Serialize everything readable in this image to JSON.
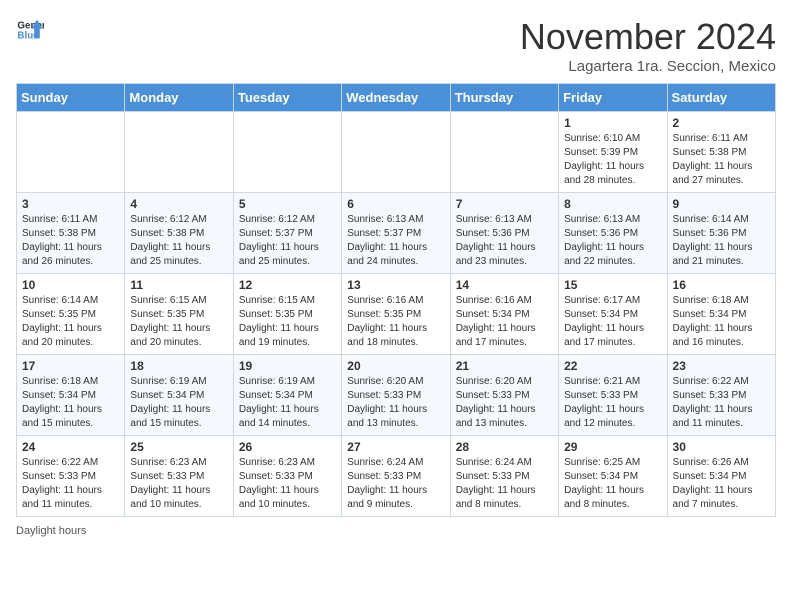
{
  "header": {
    "logo_general": "General",
    "logo_blue": "Blue",
    "month_title": "November 2024",
    "subtitle": "Lagartera 1ra. Seccion, Mexico"
  },
  "days_of_week": [
    "Sunday",
    "Monday",
    "Tuesday",
    "Wednesday",
    "Thursday",
    "Friday",
    "Saturday"
  ],
  "footer": {
    "daylight_hours": "Daylight hours"
  },
  "weeks": [
    [
      {
        "day": "",
        "content": ""
      },
      {
        "day": "",
        "content": ""
      },
      {
        "day": "",
        "content": ""
      },
      {
        "day": "",
        "content": ""
      },
      {
        "day": "",
        "content": ""
      },
      {
        "day": "1",
        "content": "Sunrise: 6:10 AM\nSunset: 5:39 PM\nDaylight: 11 hours\nand 28 minutes."
      },
      {
        "day": "2",
        "content": "Sunrise: 6:11 AM\nSunset: 5:38 PM\nDaylight: 11 hours\nand 27 minutes."
      }
    ],
    [
      {
        "day": "3",
        "content": "Sunrise: 6:11 AM\nSunset: 5:38 PM\nDaylight: 11 hours\nand 26 minutes."
      },
      {
        "day": "4",
        "content": "Sunrise: 6:12 AM\nSunset: 5:38 PM\nDaylight: 11 hours\nand 25 minutes."
      },
      {
        "day": "5",
        "content": "Sunrise: 6:12 AM\nSunset: 5:37 PM\nDaylight: 11 hours\nand 25 minutes."
      },
      {
        "day": "6",
        "content": "Sunrise: 6:13 AM\nSunset: 5:37 PM\nDaylight: 11 hours\nand 24 minutes."
      },
      {
        "day": "7",
        "content": "Sunrise: 6:13 AM\nSunset: 5:36 PM\nDaylight: 11 hours\nand 23 minutes."
      },
      {
        "day": "8",
        "content": "Sunrise: 6:13 AM\nSunset: 5:36 PM\nDaylight: 11 hours\nand 22 minutes."
      },
      {
        "day": "9",
        "content": "Sunrise: 6:14 AM\nSunset: 5:36 PM\nDaylight: 11 hours\nand 21 minutes."
      }
    ],
    [
      {
        "day": "10",
        "content": "Sunrise: 6:14 AM\nSunset: 5:35 PM\nDaylight: 11 hours\nand 20 minutes."
      },
      {
        "day": "11",
        "content": "Sunrise: 6:15 AM\nSunset: 5:35 PM\nDaylight: 11 hours\nand 20 minutes."
      },
      {
        "day": "12",
        "content": "Sunrise: 6:15 AM\nSunset: 5:35 PM\nDaylight: 11 hours\nand 19 minutes."
      },
      {
        "day": "13",
        "content": "Sunrise: 6:16 AM\nSunset: 5:35 PM\nDaylight: 11 hours\nand 18 minutes."
      },
      {
        "day": "14",
        "content": "Sunrise: 6:16 AM\nSunset: 5:34 PM\nDaylight: 11 hours\nand 17 minutes."
      },
      {
        "day": "15",
        "content": "Sunrise: 6:17 AM\nSunset: 5:34 PM\nDaylight: 11 hours\nand 17 minutes."
      },
      {
        "day": "16",
        "content": "Sunrise: 6:18 AM\nSunset: 5:34 PM\nDaylight: 11 hours\nand 16 minutes."
      }
    ],
    [
      {
        "day": "17",
        "content": "Sunrise: 6:18 AM\nSunset: 5:34 PM\nDaylight: 11 hours\nand 15 minutes."
      },
      {
        "day": "18",
        "content": "Sunrise: 6:19 AM\nSunset: 5:34 PM\nDaylight: 11 hours\nand 15 minutes."
      },
      {
        "day": "19",
        "content": "Sunrise: 6:19 AM\nSunset: 5:34 PM\nDaylight: 11 hours\nand 14 minutes."
      },
      {
        "day": "20",
        "content": "Sunrise: 6:20 AM\nSunset: 5:33 PM\nDaylight: 11 hours\nand 13 minutes."
      },
      {
        "day": "21",
        "content": "Sunrise: 6:20 AM\nSunset: 5:33 PM\nDaylight: 11 hours\nand 13 minutes."
      },
      {
        "day": "22",
        "content": "Sunrise: 6:21 AM\nSunset: 5:33 PM\nDaylight: 11 hours\nand 12 minutes."
      },
      {
        "day": "23",
        "content": "Sunrise: 6:22 AM\nSunset: 5:33 PM\nDaylight: 11 hours\nand 11 minutes."
      }
    ],
    [
      {
        "day": "24",
        "content": "Sunrise: 6:22 AM\nSunset: 5:33 PM\nDaylight: 11 hours\nand 11 minutes."
      },
      {
        "day": "25",
        "content": "Sunrise: 6:23 AM\nSunset: 5:33 PM\nDaylight: 11 hours\nand 10 minutes."
      },
      {
        "day": "26",
        "content": "Sunrise: 6:23 AM\nSunset: 5:33 PM\nDaylight: 11 hours\nand 10 minutes."
      },
      {
        "day": "27",
        "content": "Sunrise: 6:24 AM\nSunset: 5:33 PM\nDaylight: 11 hours\nand 9 minutes."
      },
      {
        "day": "28",
        "content": "Sunrise: 6:24 AM\nSunset: 5:33 PM\nDaylight: 11 hours\nand 8 minutes."
      },
      {
        "day": "29",
        "content": "Sunrise: 6:25 AM\nSunset: 5:34 PM\nDaylight: 11 hours\nand 8 minutes."
      },
      {
        "day": "30",
        "content": "Sunrise: 6:26 AM\nSunset: 5:34 PM\nDaylight: 11 hours\nand 7 minutes."
      }
    ]
  ]
}
